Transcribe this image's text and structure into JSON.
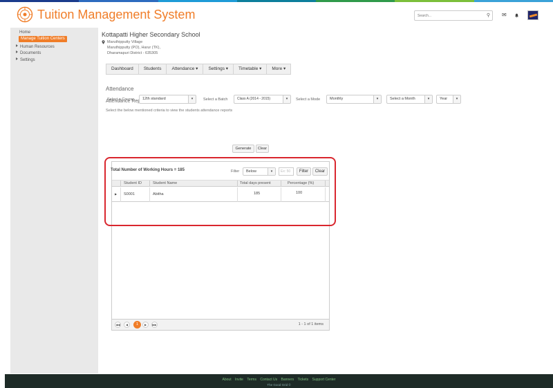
{
  "stripe_colors": [
    "#1a3b8c",
    "#2d6bbf",
    "#1e9bd7",
    "#0d7f9c",
    "#2f9a4b",
    "#7cbf3a",
    "#3aa2d8"
  ],
  "header": {
    "title": "Tuition Management System",
    "search_placeholder": "Search...",
    "accent": "#f07d28"
  },
  "sidebar": {
    "home": "Home",
    "active": "Manage Tuition Centers",
    "items": [
      "Human Resources",
      "Documents",
      "Settings"
    ]
  },
  "school": {
    "name": "Kottapatti Higher Secondary School",
    "address": [
      "Maruthipputty Village",
      "Maruthipputty (PO), Harur (TK),",
      "Dharamapuri District - 635305"
    ]
  },
  "nav": {
    "tabs": [
      "Dashboard",
      "Students",
      "Attendance ▾",
      "Settings ▾",
      "Timetable ▾",
      "More ▾"
    ]
  },
  "page": {
    "title": "Attendance",
    "subtitle": "Attendance Reports",
    "instruction": "Select the below mentioned criteria to view the students attendance reports"
  },
  "filters": {
    "course_label": "Select a Course",
    "course_value": "12th standard",
    "batch_label": "Select a Batch",
    "batch_value": "Class A (2014 - 2015)",
    "mode_label": "Select a Mode",
    "mode_value": "Monthly",
    "month_value": "Select a Month",
    "year_value": "Year",
    "generate": "Generate",
    "clear": "Clear"
  },
  "grid": {
    "hours_label": "Total Number of Working Hours = 185",
    "filter_label": "Filter",
    "filter_select": "Below",
    "filter_placeholder": "Ex: 50",
    "filter_button": "Filter",
    "clear_button": "Clear",
    "columns": [
      "Student ID",
      "Student Name",
      "Total days present",
      "Percentage (%)"
    ],
    "rows": [
      {
        "id": "S0001",
        "name": "Abitha",
        "days": "185",
        "percent": "100"
      }
    ],
    "pager": {
      "current": "1",
      "info": "1 - 1 of 1 items"
    }
  },
  "footer": {
    "links": [
      "About",
      "Invite",
      "Terms",
      "Contact Us",
      "Banners",
      "Tickets",
      "Support Center"
    ],
    "copyright": "The Good Grid ©"
  }
}
